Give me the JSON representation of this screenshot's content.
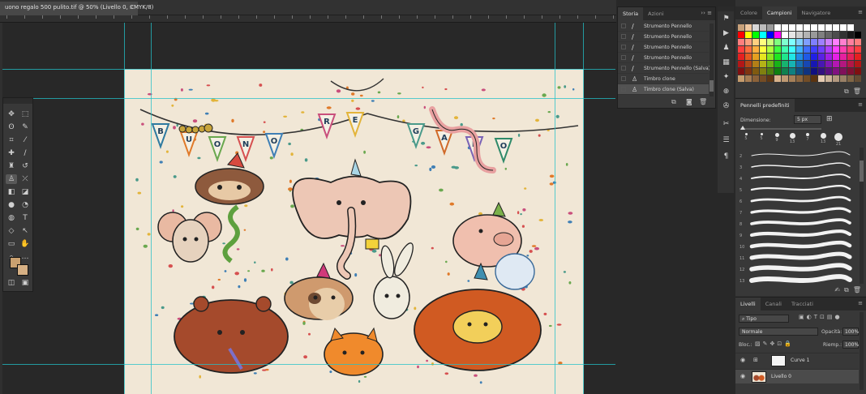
{
  "document": {
    "tab_title": "uono regalo 500 pulito.tif @ 50% (Livello 0, CMYK/8)",
    "close": "×",
    "banner_letters": [
      "B",
      "U",
      "O",
      "N",
      "O",
      "R",
      "E",
      "G",
      "A",
      "L",
      "O"
    ]
  },
  "history_panel": {
    "tabs": [
      "Storia",
      "Azioni"
    ],
    "controls": "›› ≡",
    "items": [
      {
        "label": "Strumento Pennello",
        "icon": "brush-icon"
      },
      {
        "label": "Strumento Pennello",
        "icon": "brush-icon"
      },
      {
        "label": "Strumento Pennello",
        "icon": "brush-icon"
      },
      {
        "label": "Strumento Pennello",
        "icon": "brush-icon"
      },
      {
        "label": "Strumento Pennello (Salva)",
        "icon": "brush-icon"
      },
      {
        "label": "Timbro clone",
        "icon": "stamp-icon"
      },
      {
        "label": "Timbro clone (Salva)",
        "icon": "stamp-icon",
        "selected": true
      }
    ]
  },
  "swatches_panel": {
    "tabs": [
      "Colore",
      "Campioni",
      "Navigatore"
    ],
    "active_tab": "Campioni",
    "controls": "≡"
  },
  "brush_panel": {
    "title": "Pennelli predefiniti",
    "controls": "≡",
    "dimension_label": "Dimensione:",
    "dimension_value": "5 px",
    "preset_sizes": [
      "5",
      "5",
      "9",
      "13",
      "7",
      "13",
      "21"
    ],
    "stroke_numbers": [
      "2",
      "3",
      "4",
      "5",
      "6",
      "7",
      "8",
      "9",
      "10",
      "11",
      "12",
      "13"
    ]
  },
  "layers_panel": {
    "tabs": [
      "Livelli",
      "Canali",
      "Tracciati"
    ],
    "filter": "Tipo",
    "blend_mode": "Normale",
    "opacity_label": "Opacità:",
    "opacity_value": "100%",
    "lock_label": "Bloc.:",
    "fill_label": "Riemp.:",
    "fill_value": "100%",
    "layers": [
      {
        "name": "Curve 1",
        "type": "adjustment"
      },
      {
        "name": "Livello 0",
        "type": "pixel",
        "selected": true
      }
    ]
  },
  "colors": {
    "foreground": "#caa170",
    "background": "#d6b084",
    "canvas_paper": "#f1e7d6",
    "guide": "#22c0c8"
  }
}
